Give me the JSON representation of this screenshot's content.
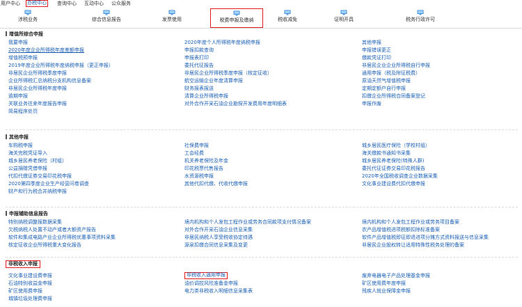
{
  "top_nav": [
    {
      "label": "用户中心",
      "active": false
    },
    {
      "label": "办税中心",
      "active": true
    },
    {
      "label": "查询中心",
      "active": false
    },
    {
      "label": "互动中心",
      "active": false
    },
    {
      "label": "公众服务",
      "active": false
    }
  ],
  "toolbar": [
    {
      "label": "涉税业务",
      "active": false
    },
    {
      "label": "综合信息报告",
      "active": false
    },
    {
      "label": "发票使用",
      "active": false
    },
    {
      "label": "税费申报及缴纳",
      "active": true
    },
    {
      "label": "税收减免",
      "active": false
    },
    {
      "label": "证明开具",
      "active": false
    },
    {
      "label": "税务行政许可",
      "active": false
    }
  ],
  "colors": {
    "link": "#1a5fb4",
    "highlight": "#e11c1c",
    "icon": "#2b7fd4"
  },
  "sections": [
    {
      "title": "增值所综合申报",
      "boxed": false,
      "columns": [
        [
          "我要申报",
          "2020年度企业所得税年度差额申报",
          "增值税预申报",
          "2019年度企业所得税年度纳税申报（更正申报）",
          "非居民企业所得税季度申报",
          "企业所得税汇总纳税分支机构信息备案",
          "非居民企业所得税年度申报",
          "逾期申报",
          "关联业务往来年度报告申报",
          "简易程序处罚"
        ],
        [
          "2020年度个人所得税年度纳税申报",
          "申报扣款查询",
          "申报表打印",
          "委托代征报告",
          "非居民企业所得税季度申报（核定征收）",
          "航空运输企业年度清算申报",
          "财务报表报送",
          "清算企业所得税申报",
          "对外合作开采石油企业勘探开发费用年度明细表"
        ],
        [
          "其他申报",
          "申报错误更正",
          "缴款凭证打印",
          "非居民企业企业所得税自行申报",
          "通用申报（税及附征税费）",
          "原油天然气增值税申报",
          "定期定额户自行申报",
          "扣缴企业所得税合同备案登记",
          "申报作废"
        ]
      ],
      "underlined": [
        "2020年度企业所得税年度差额申报"
      ]
    },
    {
      "title": "其他申报",
      "boxed": false,
      "columns": [
        [
          "车购税申报",
          "海关完税凭证导入",
          "城乡居民养老保险（村组）",
          "公益捐赠凭借申报",
          "代扣代缴证券交易印花税申报",
          "2020第四季度企业生产经营问卷调查",
          "财产和行为税合并纳税申报"
        ],
        [
          "社保费申报",
          "工会经费",
          "机关养老保险及年金",
          "印花税票代售报告",
          "水资源税申报",
          "其他代扣代缴、代收代缴申报"
        ],
        [
          "城乡居民医疗保险（学校村组）",
          "海关缴款书通知书采集",
          "城乡居民养老保险(特殊人群)",
          "委托代征证券交易印花税报告",
          "2020年全国税收调查企业数据采集",
          "文化事业建设费代扣代缴申报"
        ]
      ],
      "underlined": []
    },
    {
      "title": "申报辅助信息报告",
      "boxed": false,
      "columns": [
        [
          "特别纳税调整报数据采集",
          "欠税纳税人处置不动产或者大额资产报告",
          "软件和集成电路产业企业所得税优惠事项资料采集",
          "核定征收企业所得税重大变化报告"
        ],
        [
          "境内机构和个人发包工程作业或劳务合同款项支付情况备案",
          "对外合作开采石油企业信息采集",
          "非居民纳税人享受税收协定待遇",
          "源泉扣缴合同信息采集及变更"
        ],
        [
          "境内机构和个人发包工程作业或劳务项目备案",
          "农产品增值税进项税额扣除标准备案",
          "软件产品增值税即征即退进项分摊方式资料报送与信息采集",
          "非居民企业股权转让适用特殊性税务处理的备案"
        ]
      ],
      "underlined": []
    },
    {
      "title": "非税收入申报",
      "boxed": true,
      "columns": [
        [
          "文化事业建设费申报",
          "石油特别收益金申报",
          "矿区使用费申报",
          "城镇垃圾处理费申报"
        ],
        [
          "非税收入通用申报",
          "油价调控风险准备金申报",
          "电力类非税收入明细信息采集表"
        ],
        [
          "废弃电器电子产品处理基金申报",
          "矿区使用费年度申报",
          "残疾人就业保障金申报"
        ]
      ],
      "underlined": [],
      "boxed_items": [
        "非税收入通用申报"
      ]
    }
  ]
}
